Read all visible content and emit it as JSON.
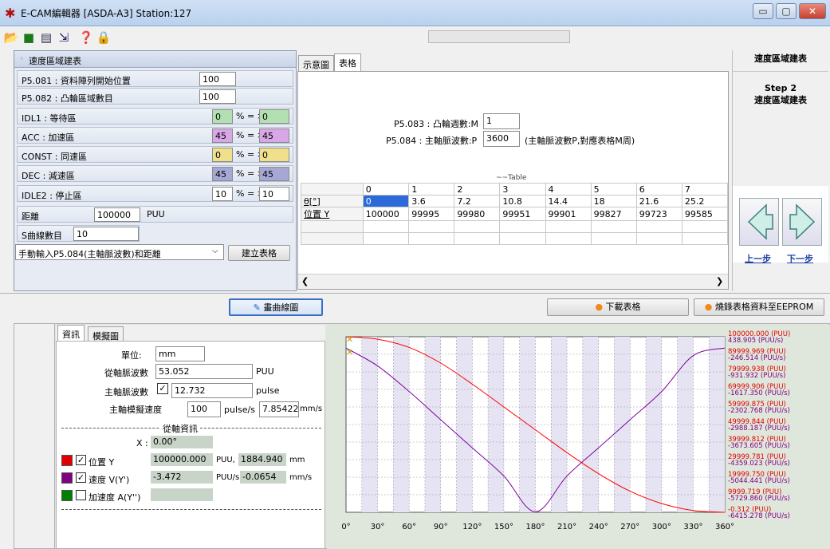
{
  "window": {
    "title": "E-CAM編輯器 [ASDA-A3] Station:127",
    "controls": {
      "minimize": "▭",
      "maximize": "▢",
      "close": "✕"
    }
  },
  "toolbar": {
    "icons": [
      "open-folder-icon",
      "save-icon",
      "document-icon",
      "export-icon",
      "help-icon",
      "lock-icon"
    ]
  },
  "speed_panel": {
    "header": "速度區域建表",
    "rows": [
      {
        "label": "P5.081 : 資料陣列開始位置",
        "value": "100"
      },
      {
        "label": "P5.082 : 凸輪區域數目",
        "value": "100"
      }
    ],
    "zones": [
      {
        "label": "IDL1 : 等待區",
        "value": "0",
        "arrow": "% = >",
        "result": "0",
        "color": "#b2e0b2"
      },
      {
        "label": "ACC : 加速區",
        "value": "45",
        "arrow": "% = >",
        "result": "45",
        "color": "#d9a6e8"
      },
      {
        "label": "CONST : 同速區",
        "value": "0",
        "arrow": "% = >",
        "result": "0",
        "color": "#f0e08c"
      },
      {
        "label": "DEC : 減速區",
        "value": "45",
        "arrow": "% = >",
        "result": "45",
        "color": "#a7a7d6"
      },
      {
        "label": "IDLE2 : 停止區",
        "value": "10",
        "arrow": "% = >",
        "result": "10",
        "color": "#ffffff"
      }
    ],
    "distance": {
      "label": "距離",
      "value": "100000",
      "unit": "PUU"
    },
    "s_curve": {
      "label": "S曲線數目",
      "value": "10"
    },
    "mode_select": "手動輸入P5.084(主軸脈波數)和距離",
    "build_button": "建立表格"
  },
  "table_panel": {
    "tabs": [
      "示意圖",
      "表格"
    ],
    "p5083_label": "P5.083 : 凸輪週數:M",
    "p5083_value": "1",
    "p5084_label": "P5.084 : 主軸脈波數:P",
    "p5084_value": "3600",
    "p5084_note": "(主軸脈波數P,對應表格M周)",
    "overlay_text": "~~Table",
    "columns": [
      "0",
      "1",
      "2",
      "3",
      "4",
      "5",
      "6",
      "7"
    ],
    "rows": [
      {
        "header": "θ[°]",
        "cells": [
          "0",
          "3.6",
          "7.2",
          "10.8",
          "14.4",
          "18",
          "21.6",
          "25.2"
        ]
      },
      {
        "header": "位置 Y",
        "cells": [
          "100000",
          "99995",
          "99980",
          "99951",
          "99901",
          "99827",
          "99723",
          "99585"
        ]
      }
    ]
  },
  "step_panel": {
    "title": "速度區域建表",
    "step": "Step 2",
    "step_name": "速度區域建表",
    "prev_label": "上一步",
    "next_label": "下一步"
  },
  "action_bar": {
    "draw_button": "畫曲線圖",
    "download_button": "下載表格",
    "burn_button": "燒錄表格資料至EEPROM"
  },
  "info_panel": {
    "tabs": [
      "資訊",
      "模擬圖"
    ],
    "unit_label": "單位:",
    "unit_value": "mm",
    "slave_pulse_label": "從軸脈波數",
    "slave_pulse_value": "53.052",
    "slave_pulse_unit": "PUU",
    "master_pulse_label": "主軸脈波數",
    "master_pulse_value": "12.732",
    "master_pulse_unit": "pulse",
    "sim_speed_label": "主軸模擬速度",
    "sim_speed_value": "100",
    "sim_speed_unit": "pulse/s",
    "sim_speed_mm": "7.854225",
    "sim_speed_mm_unit": "mm/s",
    "slave_info_title": "從軸資訊",
    "x_label": "X :",
    "x_value": "0.00°",
    "signals": [
      {
        "label": "位置 Y",
        "color": "#e00000",
        "checked": true,
        "value": "100000.000",
        "unit": "PUU,",
        "value2": "1884.940",
        "unit2": "mm"
      },
      {
        "label": "速度 V(Y')",
        "color": "#800080",
        "checked": true,
        "value": "-3.472",
        "unit": "PUU/s,",
        "value2": "-0.0654",
        "unit2": "mm/s"
      },
      {
        "label": "加速度 A(Y'')",
        "color": "#008000",
        "checked": false,
        "value": "",
        "unit": "",
        "value2": "",
        "unit2": ""
      }
    ]
  },
  "chart_data": {
    "type": "line",
    "x": [
      0,
      30,
      60,
      90,
      120,
      150,
      180,
      210,
      240,
      270,
      300,
      330,
      360
    ],
    "x_tick_labels": [
      "0°",
      "30°",
      "60°",
      "90°",
      "120°",
      "150°",
      "180°",
      "210°",
      "240°",
      "270°",
      "300°",
      "330°",
      "360°"
    ],
    "xlim": [
      0,
      360
    ],
    "series": [
      {
        "name": "位置 Y",
        "color": "#ff0000",
        "values": [
          100000,
          98600,
          93900,
          85000,
          73000,
          60000,
          47000,
          34000,
          22000,
          12000,
          5000,
          1000,
          0
        ]
      },
      {
        "name": "速度 V(Y')",
        "color": "#8000a0",
        "values": [
          -3.5,
          -700,
          -1700,
          -2800,
          -3900,
          -5000,
          -6400,
          -5000,
          -3900,
          -2800,
          -1700,
          -300,
          0
        ]
      }
    ],
    "right_axis_labels": [
      {
        "pos": "100000.000",
        "vel": "438.905"
      },
      {
        "pos": "89999.969",
        "vel": "-246.514"
      },
      {
        "pos": "79999.938",
        "vel": "-931.932"
      },
      {
        "pos": "69999.906",
        "vel": "-1617.350"
      },
      {
        "pos": "59999.875",
        "vel": "-2302.768"
      },
      {
        "pos": "49999.844",
        "vel": "-2988.187"
      },
      {
        "pos": "39999.812",
        "vel": "-3673.605"
      },
      {
        "pos": "29999.781",
        "vel": "-4359.023"
      },
      {
        "pos": "19999.750",
        "vel": "-5044.441"
      },
      {
        "pos": "9999.719",
        "vel": "-5729.860"
      },
      {
        "pos": "-0.312",
        "vel": "-6415.278"
      }
    ],
    "pos_unit": "(PUU)",
    "vel_unit": "(PUU/s)",
    "grid": true,
    "ylim_pos": [
      -0.312,
      100000
    ],
    "ylim_vel": [
      -6415.278,
      438.905
    ]
  }
}
